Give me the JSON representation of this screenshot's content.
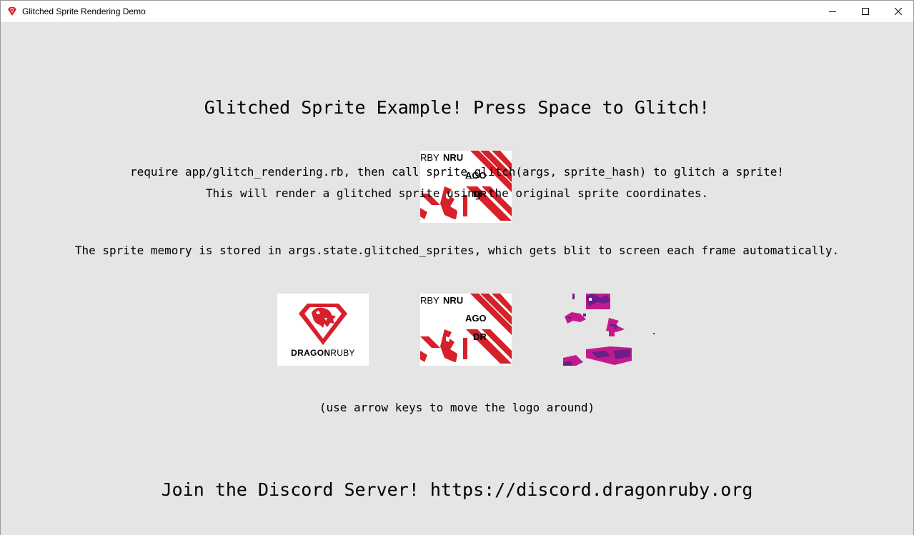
{
  "window": {
    "title": "Glitched Sprite Rendering Demo",
    "icon": "dragonruby-gem-icon",
    "controls": [
      "minimize-icon",
      "maximize-icon",
      "close-icon"
    ]
  },
  "text": {
    "heading": "Glitched Sprite Example! Press Space to Glitch!",
    "info_line_1": "require app/glitch_rendering.rb, then call sprite_glitch(args, sprite_hash) to glitch a sprite!",
    "info_line_2": "This will render a glitched sprite using the original sprite coordinates.",
    "info_line_3": "The sprite memory is stored in args.state.glitched_sprites, which gets blit to screen each frame automatically.",
    "hint": "(use arrow keys to move the logo around)",
    "discord": "Join the Discord Server! https://discord.dragonruby.org"
  },
  "sprites": {
    "logo": {
      "word_bold": "DRAGON",
      "word_light": "RUBY"
    },
    "glitch_fragments": [
      "RBY",
      "NRU",
      "AGO",
      "DR"
    ]
  },
  "colors": {
    "background": "#e5e5e5",
    "brand_red": "#d6202a",
    "dragon_magenta": "#c21a8c",
    "dragon_purple": "#6a1e8a"
  }
}
